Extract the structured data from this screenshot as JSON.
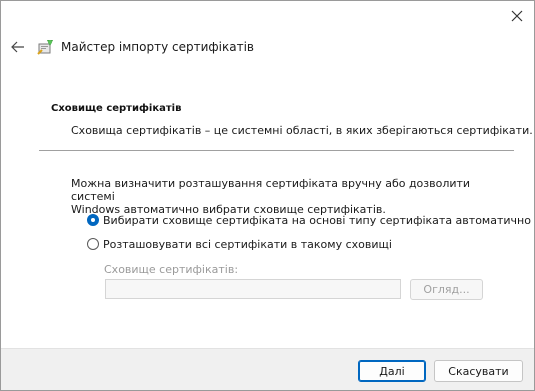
{
  "window": {
    "close_icon": "close-icon"
  },
  "header": {
    "back_icon": "back-arrow-icon",
    "wizard_icon": "certificate-wizard-icon",
    "title": "Майстер імпорту сертифікатів"
  },
  "section": {
    "title": "Сховище сертифікатів",
    "description": "Сховища сертифікатів – це системні області, в яких зберігаються сертифікати."
  },
  "intro": {
    "line1": "Можна визначити розташування сертифіката вручну або дозволити системі",
    "line2": "Windows автоматично вибрати сховище сертифікатів."
  },
  "options": [
    {
      "label": "Вибирати сховище сертифіката на основі типу сертифіката автоматично",
      "checked": true
    },
    {
      "label": "Розташовувати всі сертифікати в такому сховищі",
      "checked": false
    }
  ],
  "store": {
    "label": "Сховище сертифікатів:",
    "value": "",
    "browse_label": "Огляд..."
  },
  "footer": {
    "next_label": "Далі",
    "cancel_label": "Скасувати"
  },
  "colors": {
    "accent": "#0067c0",
    "disabled_text": "#a0a0a0"
  }
}
